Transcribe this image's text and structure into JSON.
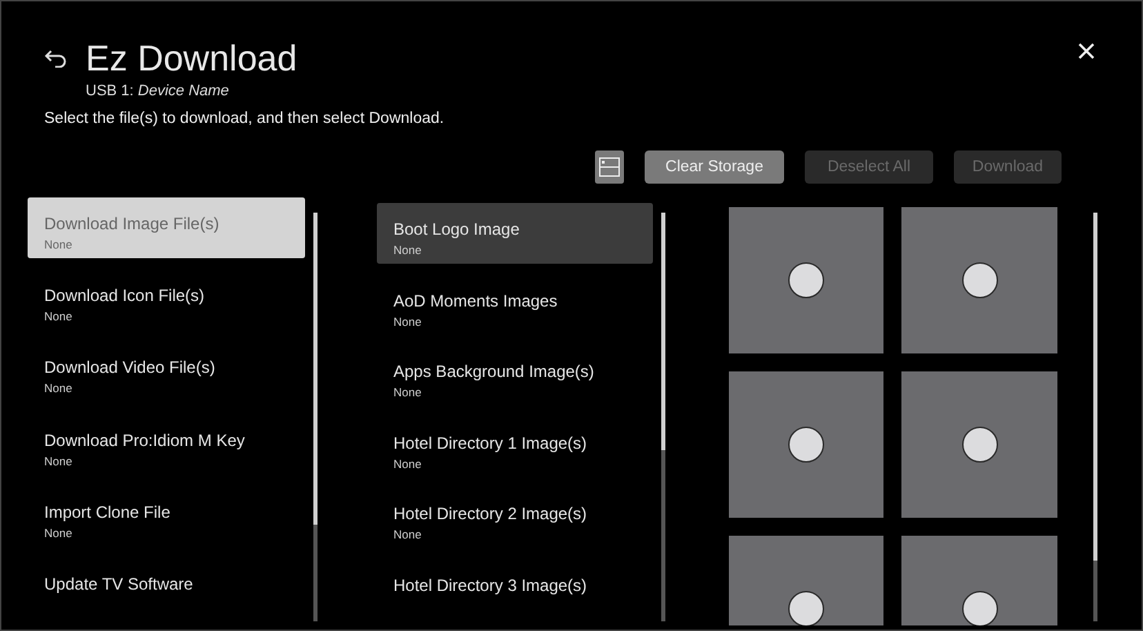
{
  "header": {
    "title": "Ez Download",
    "subtitle": "USB 1: *Device Name*",
    "instruction": "Select the file(s) to download, and then select Download."
  },
  "toolbar": {
    "buttons": [
      {
        "label": "Clear Storage",
        "disabled": false
      },
      {
        "label": "Deselect All",
        "disabled": true
      },
      {
        "label": "Download",
        "disabled": true
      }
    ]
  },
  "categories": [
    {
      "label": "Download Image File(s)",
      "value": "None",
      "selected": true
    },
    {
      "label": "Download Icon File(s)",
      "value": "None",
      "selected": false
    },
    {
      "label": "Download Video File(s)",
      "value": "None",
      "selected": false
    },
    {
      "label": "Download Pro:Idiom M Key",
      "value": "None",
      "selected": false
    },
    {
      "label": "Import Clone File",
      "value": "None",
      "selected": false
    },
    {
      "label": "Update TV Software",
      "selected": false
    }
  ],
  "files": [
    {
      "label": "Boot Logo Image",
      "value": "None",
      "selected": true
    },
    {
      "label": "AoD Moments Images",
      "value": "None",
      "selected": false
    },
    {
      "label": "Apps Background Image(s)",
      "value": "None",
      "selected": false
    },
    {
      "label": "Hotel Directory 1 Image(s)",
      "value": "None",
      "selected": false
    },
    {
      "label": "Hotel Directory 2 Image(s)",
      "value": "None",
      "selected": false
    },
    {
      "label": "Hotel Directory 3 Image(s)",
      "selected": false
    }
  ],
  "thumbnails": [
    {
      "checked": false
    },
    {
      "checked": false
    },
    {
      "checked": false
    },
    {
      "checked": false
    },
    {
      "checked": false
    },
    {
      "checked": false
    }
  ]
}
